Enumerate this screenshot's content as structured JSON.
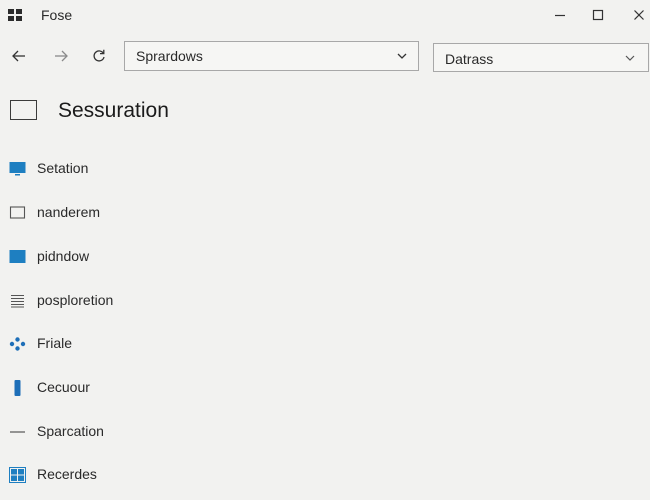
{
  "window": {
    "title": "Fose"
  },
  "address": {
    "value": "Sprardows"
  },
  "data_select": {
    "value": "Datrass"
  },
  "page": {
    "heading": "Sessuration"
  },
  "items": [
    {
      "label": "Setation",
      "icon": "monitor-icon",
      "color": "#1e7fc1"
    },
    {
      "label": "nanderem",
      "icon": "window-outline-icon",
      "color": "#555555"
    },
    {
      "label": "pidndow",
      "icon": "window-filled-icon",
      "color": "#1e7fc1"
    },
    {
      "label": "posplоretion",
      "icon": "lines-icon",
      "color": "#555555"
    },
    {
      "label": "Friale",
      "icon": "gamepad-icon",
      "color": "#1e6fb8"
    },
    {
      "label": "Cecuour",
      "icon": "phone-icon",
      "color": "#1e6fb8"
    },
    {
      "label": "Sparcation",
      "icon": "dash-icon",
      "color": "#555555"
    },
    {
      "label": "Recerdes",
      "icon": "grid-icon",
      "color": "#1e7fc1"
    }
  ]
}
